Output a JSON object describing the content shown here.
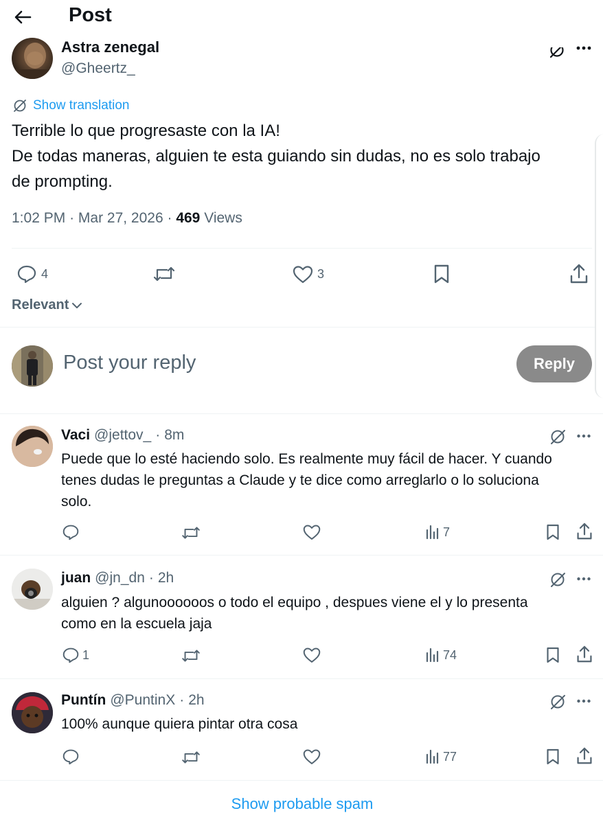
{
  "header": {
    "title": "Post"
  },
  "post": {
    "author_name": "Astra zenegal",
    "author_handle": "@Gheertz_",
    "show_translation": "Show translation",
    "text_lines": [
      "Terrible lo que progresaste con la IA!",
      "De todas maneras, alguien te esta guiando sin dudas, no es solo trabajo",
      "de prompting."
    ],
    "time": "1:02 PM",
    "date": "Mar 27, 2026",
    "views_count": "469",
    "views_label": "Views",
    "replies": "4",
    "likes": "3"
  },
  "sort": {
    "label": "Relevant"
  },
  "composer": {
    "placeholder": "Post your reply",
    "button": "Reply"
  },
  "replies": [
    {
      "name": "Vaci",
      "handle": "@jettov_",
      "time": "8m",
      "lines": [
        "Puede que lo esté haciendo solo. Es realmente muy fácil de hacer. Y cuando",
        "tenes dudas le preguntas a Claude y te dice como arreglarlo o lo soluciona",
        "solo."
      ],
      "reply_count": "",
      "views": "7"
    },
    {
      "name": "juan",
      "handle": "@jn_dn",
      "time": "2h",
      "lines": [
        "alguien ? algunoooooos o todo el equipo , despues viene el y lo presenta",
        "como en la escuela jaja"
      ],
      "reply_count": "1",
      "views": "74"
    },
    {
      "name": "Puntín",
      "handle": "@PuntinX",
      "time": "2h",
      "lines": [
        "100% aunque quiera pintar otra cosa"
      ],
      "reply_count": "",
      "views": "77"
    }
  ],
  "footer": {
    "spam_link": "Show probable spam"
  },
  "colors": {
    "accent": "#1d9bf0",
    "secondary_text": "#536471",
    "reply_button": "#8a8a8a"
  }
}
